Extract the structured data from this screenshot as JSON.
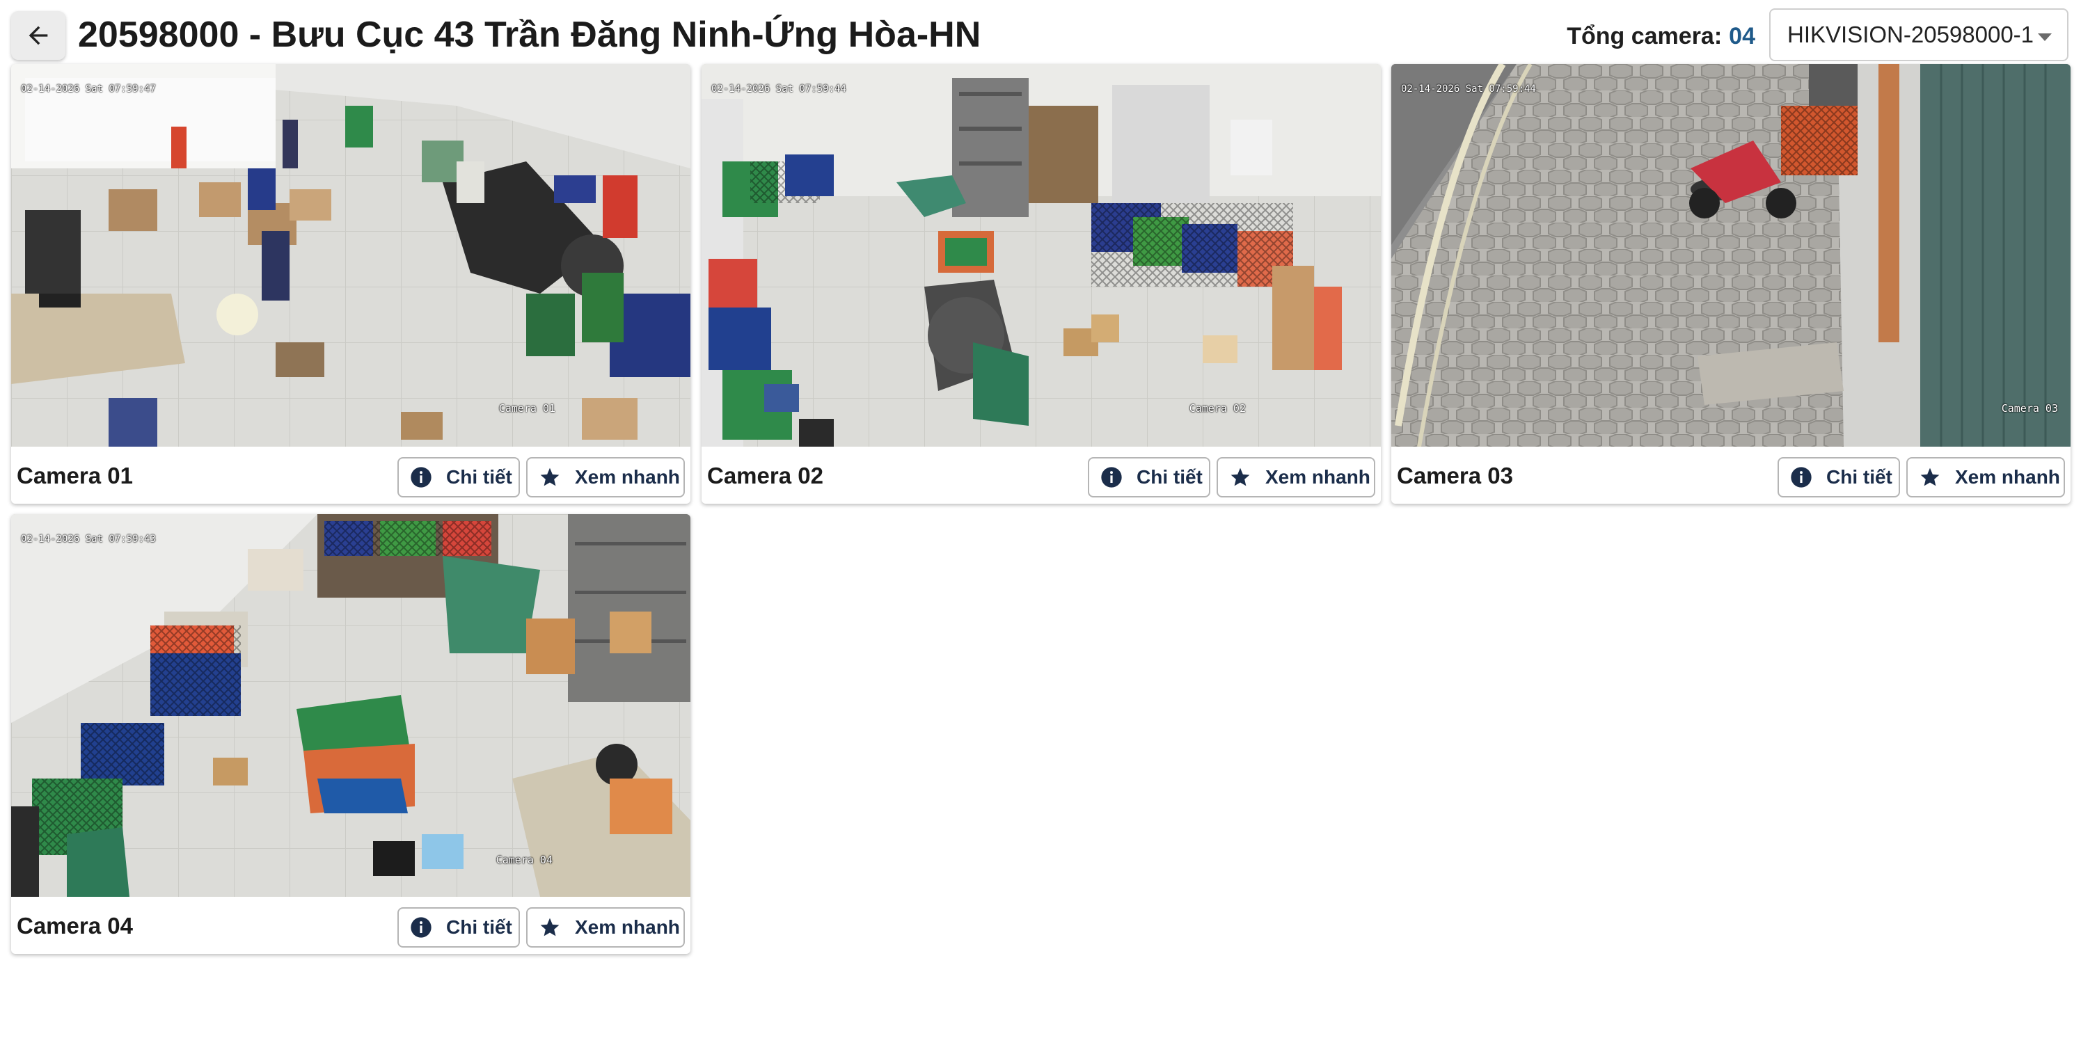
{
  "header": {
    "back_icon": "arrow-left-icon",
    "title": "20598000 - Bưu Cục 43 Trần Đăng Ninh-Ứng Hòa-HN",
    "total_label": "Tổng camera:",
    "total_value": "04",
    "device_select": {
      "value": "HIKVISION-20598000-1",
      "icon": "caret-down-icon"
    }
  },
  "colors": {
    "accent": "#1f5a8a",
    "button_text": "#1b2d4a",
    "button_border": "#b5b5b5"
  },
  "cameras": [
    {
      "name": "Camera 01",
      "osd_time": "02-14-2026 Sat 07:59:47",
      "osd_label": "Camera 01",
      "detail_label": "Chi tiết",
      "quick_label": "Xem nhanh"
    },
    {
      "name": "Camera 02",
      "osd_time": "02-14-2026 Sat 07:59:44",
      "osd_label": "Camera 02",
      "detail_label": "Chi tiết",
      "quick_label": "Xem nhanh"
    },
    {
      "name": "Camera 03",
      "osd_time": "02-14-2026 Sat 07:59:44",
      "osd_label": "Camera 03",
      "detail_label": "Chi tiết",
      "quick_label": "Xem nhanh"
    },
    {
      "name": "Camera 04",
      "osd_time": "02-14-2026 Sat 07:59:43",
      "osd_label": "Camera 04",
      "detail_label": "Chi tiết",
      "quick_label": "Xem nhanh"
    }
  ],
  "icons": {
    "detail": "info-circle-icon",
    "quick": "star-icon"
  }
}
